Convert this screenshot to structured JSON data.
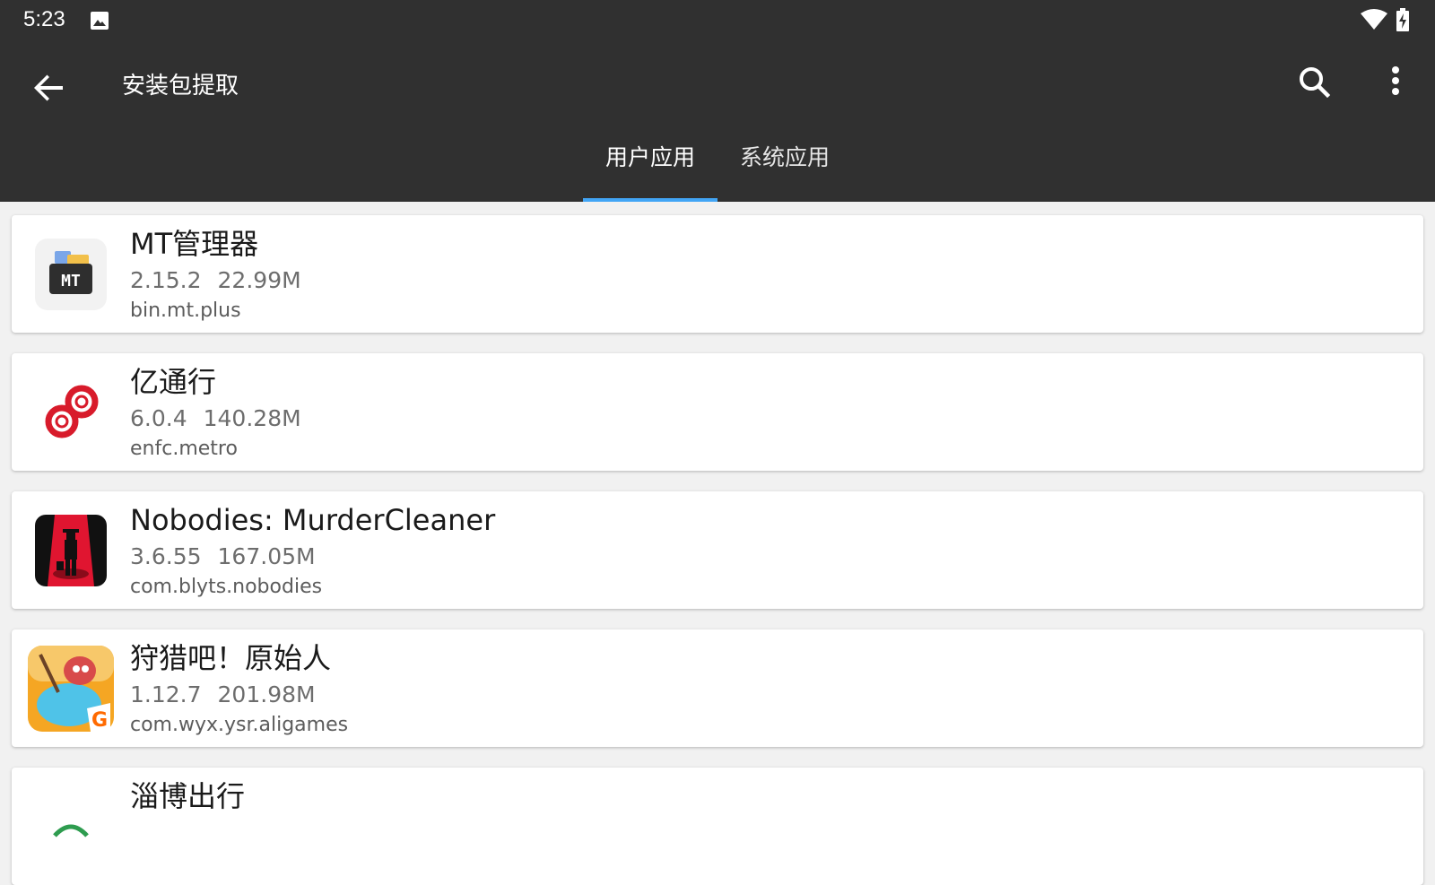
{
  "status_bar": {
    "time": "5:23",
    "icons": [
      "image-icon",
      "wifi-icon",
      "battery-charging-icon"
    ]
  },
  "app_bar": {
    "title": "安装包提取",
    "back_icon": "arrow-back-icon",
    "search_icon": "search-icon",
    "more_icon": "more-vert-icon"
  },
  "tabs": [
    {
      "label": "用户应用",
      "selected": true
    },
    {
      "label": "系统应用",
      "selected": false
    }
  ],
  "colors": {
    "toolbar": "#303030",
    "tab_indicator": "#42a5f5",
    "background": "#f1f1f1"
  },
  "apps": [
    {
      "name": "MT管理器",
      "version": "2.15.2",
      "size": "22.99M",
      "package": "bin.mt.plus",
      "icon": "mt-manager-icon"
    },
    {
      "name": "亿通行",
      "version": "6.0.4",
      "size": "140.28M",
      "package": "enfc.metro",
      "icon": "yitongxing-icon"
    },
    {
      "name": "Nobodies: MurderCleaner",
      "version": "3.6.55",
      "size": "167.05M",
      "package": "com.blyts.nobodies",
      "icon": "nobodies-icon"
    },
    {
      "name": "狩猎吧！原始人",
      "version": "1.12.7",
      "size": "201.98M",
      "package": "com.wyx.ysr.aligames",
      "icon": "hunting-caveman-icon"
    },
    {
      "name": "淄博出行",
      "icon": "zibo-chuxing-icon"
    }
  ]
}
